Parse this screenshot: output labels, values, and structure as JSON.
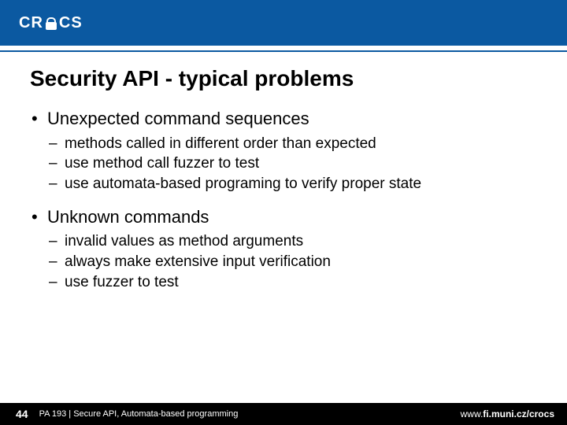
{
  "header": {
    "logo_left": "CR",
    "logo_right": "CS"
  },
  "title": "Security API - typical problems",
  "bullets": [
    {
      "text": "Unexpected command sequences",
      "sub": [
        "methods called in different order than expected",
        "use method call fuzzer to test",
        "use automata-based programing to verify proper state"
      ]
    },
    {
      "text": "Unknown commands",
      "sub": [
        "invalid values as method arguments",
        "always make extensive input verification",
        "use fuzzer to test"
      ]
    }
  ],
  "footer": {
    "page": "44",
    "text": "PA 193 | Secure API, Automata-based programming",
    "url_prefix": "www.",
    "url_main": "fi.muni.cz/crocs"
  }
}
